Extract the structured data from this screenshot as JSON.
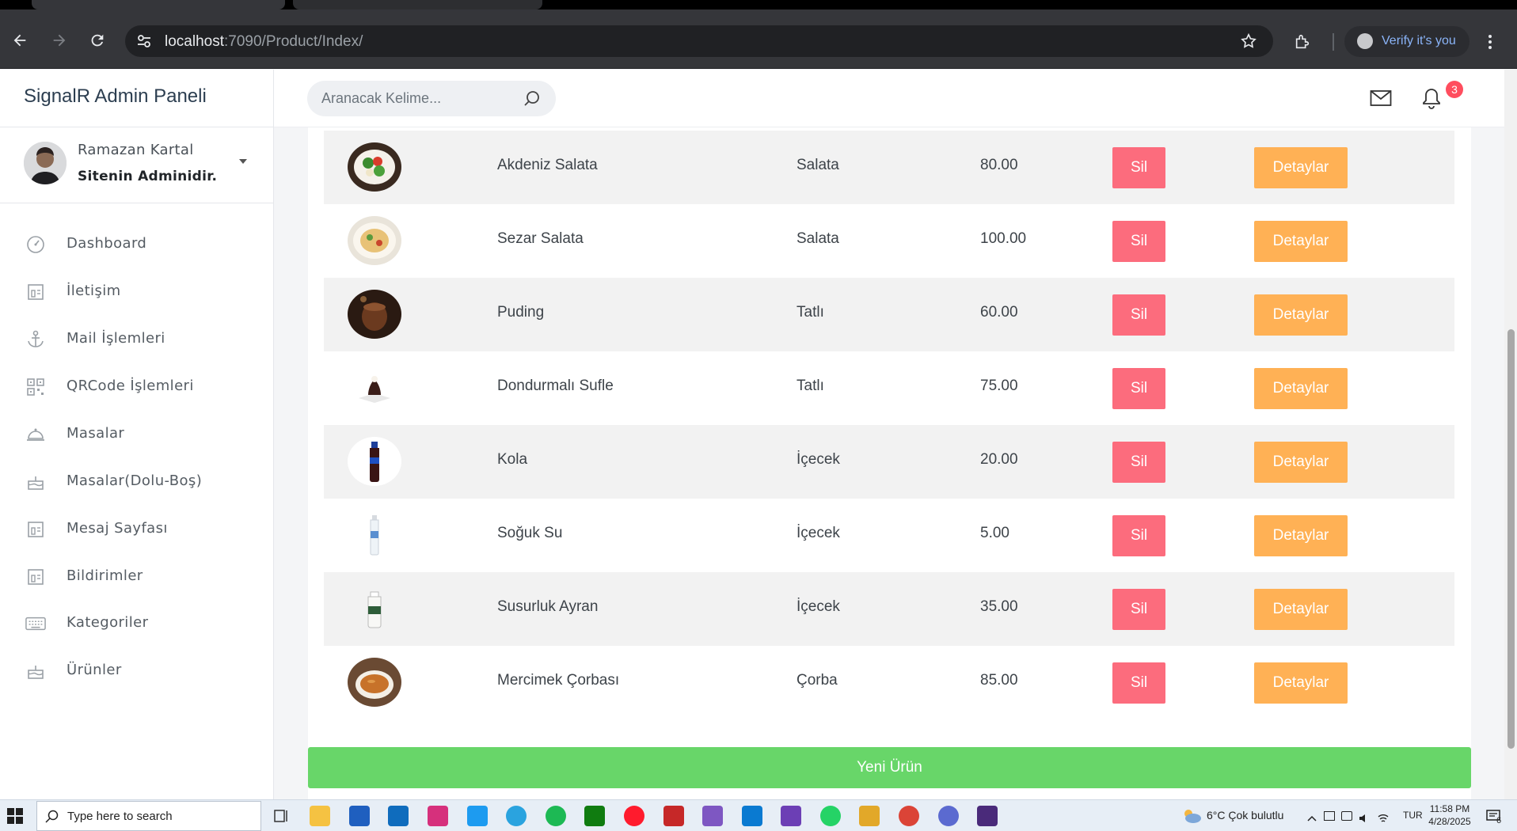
{
  "browser": {
    "url_host": "localhost",
    "url_path": ":7090/Product/Index/",
    "verify_label": "Verify it's you"
  },
  "app": {
    "brand": "SignalR Admin Paneli",
    "search_placeholder": "Aranacak Kelime...",
    "notification_count": "3"
  },
  "profile": {
    "name": "Ramazan Kartal",
    "role": "Sitenin Adminidir."
  },
  "menu": [
    {
      "label": "Dashboard",
      "icon": "speedometer-icon"
    },
    {
      "label": "İletişim",
      "icon": "contact-card-icon"
    },
    {
      "label": "Mail İşlemleri",
      "icon": "anchor-icon"
    },
    {
      "label": "QRCode İşlemleri",
      "icon": "qrcode-icon"
    },
    {
      "label": "Masalar",
      "icon": "cloche-icon"
    },
    {
      "label": "Masalar(Dolu-Boş)",
      "icon": "cake-icon"
    },
    {
      "label": "Mesaj Sayfası",
      "icon": "contact-card-icon"
    },
    {
      "label": "Bildirimler",
      "icon": "contact-card-icon"
    },
    {
      "label": "Kategoriler",
      "icon": "keyboard-icon"
    },
    {
      "label": "Ürünler",
      "icon": "cake-icon"
    }
  ],
  "products": [
    {
      "name": "Akdeniz Salata",
      "category": "Salata",
      "price": "80.00",
      "image": "salad"
    },
    {
      "name": "Sezar Salata",
      "category": "Salata",
      "price": "100.00",
      "image": "pasta-salad"
    },
    {
      "name": "Puding",
      "category": "Tatlı",
      "price": "60.00",
      "image": "pudding"
    },
    {
      "name": "Dondurmalı Sufle",
      "category": "Tatlı",
      "price": "75.00",
      "image": "souffle"
    },
    {
      "name": "Kola",
      "category": "İçecek",
      "price": "20.00",
      "image": "cola"
    },
    {
      "name": "Soğuk Su",
      "category": "İçecek",
      "price": "5.00",
      "image": "water"
    },
    {
      "name": "Susurluk Ayran",
      "category": "İçecek",
      "price": "35.00",
      "image": "ayran"
    },
    {
      "name": "Mercimek Çorbası",
      "category": "Çorba",
      "price": "85.00",
      "image": "soup"
    }
  ],
  "actions": {
    "delete_label": "Sil",
    "details_label": "Detaylar",
    "new_product_label": "Yeni Ürün"
  },
  "taskbar": {
    "search_placeholder": "Type here to search",
    "weather": "6°C  Çok bulutlu",
    "lang": "TUR",
    "time": "11:58 PM",
    "date": "4/28/2025",
    "notif_count": "6"
  },
  "colors": {
    "delete": "#fc6c7d",
    "details": "#ffb155",
    "new_product": "#68d669",
    "badge": "#ff4d5e"
  }
}
